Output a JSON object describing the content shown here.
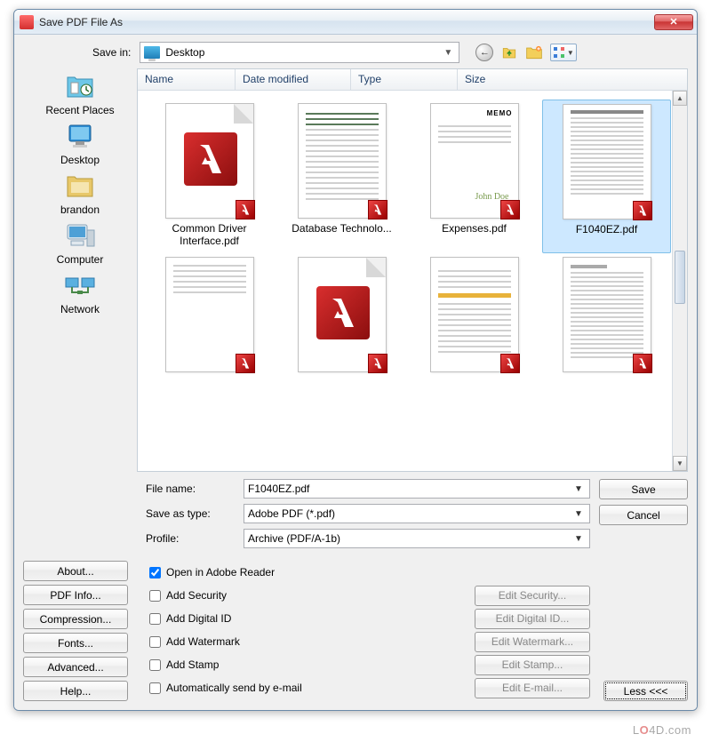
{
  "window": {
    "title": "Save PDF File As"
  },
  "savein": {
    "label": "Save in:",
    "value": "Desktop"
  },
  "columns": {
    "name": "Name",
    "date": "Date modified",
    "type": "Type",
    "size": "Size"
  },
  "places": [
    {
      "label": "Recent Places"
    },
    {
      "label": "Desktop"
    },
    {
      "label": "brandon"
    },
    {
      "label": "Computer"
    },
    {
      "label": "Network"
    }
  ],
  "files": [
    {
      "name": "Common Driver Interface.pdf",
      "selected": false,
      "preview": "adobe"
    },
    {
      "name": "Database Technolo...",
      "selected": false,
      "preview": "lines-green"
    },
    {
      "name": "Expenses.pdf",
      "selected": false,
      "preview": "memo"
    },
    {
      "name": "F1040EZ.pdf",
      "selected": true,
      "preview": "form"
    },
    {
      "name": "",
      "selected": false,
      "preview": "lines-top"
    },
    {
      "name": "",
      "selected": false,
      "preview": "adobe"
    },
    {
      "name": "",
      "selected": false,
      "preview": "lines-yellow"
    },
    {
      "name": "",
      "selected": false,
      "preview": "lines-dense"
    }
  ],
  "form": {
    "filename_label": "File name:",
    "filename_value": "F1040EZ.pdf",
    "saveas_label": "Save as type:",
    "saveas_value": "Adobe PDF (*.pdf)",
    "profile_label": "Profile:",
    "profile_value": "Archive (PDF/A-1b)",
    "save_button": "Save",
    "cancel_button": "Cancel"
  },
  "left_buttons": {
    "about": "About...",
    "pdfinfo": "PDF Info...",
    "compression": "Compression...",
    "fonts": "Fonts...",
    "advanced": "Advanced...",
    "help": "Help..."
  },
  "options": {
    "open_reader": {
      "label": "Open in Adobe Reader",
      "checked": true
    },
    "add_security": {
      "label": "Add Security",
      "checked": false,
      "edit": "Edit Security..."
    },
    "add_digitalid": {
      "label": "Add Digital ID",
      "checked": false,
      "edit": "Edit Digital ID..."
    },
    "add_watermark": {
      "label": "Add Watermark",
      "checked": false,
      "edit": "Edit Watermark..."
    },
    "add_stamp": {
      "label": "Add Stamp",
      "checked": false,
      "edit": "Edit Stamp..."
    },
    "auto_email": {
      "label": "Automatically send by e-mail",
      "checked": false,
      "edit": "Edit E-mail..."
    }
  },
  "less_button": "Less <<<",
  "watermark": {
    "prefix": "L",
    "o": "O",
    "suffix": "4D.com"
  }
}
